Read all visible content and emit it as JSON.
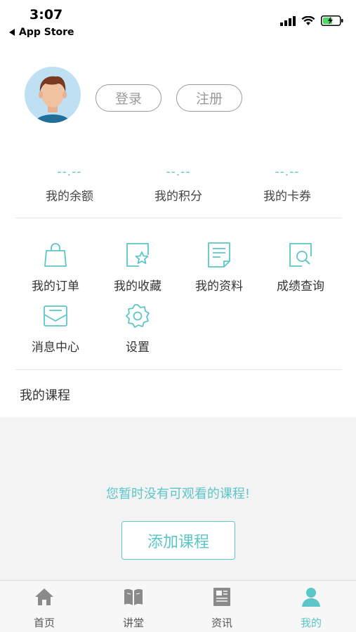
{
  "status_bar": {
    "time": "3:07",
    "back_label": "App Store"
  },
  "profile": {
    "login_label": "登录",
    "register_label": "注册"
  },
  "stats": [
    {
      "value": "--.--",
      "label": "我的余额"
    },
    {
      "value": "--.--",
      "label": "我的积分"
    },
    {
      "value": "--.--",
      "label": "我的卡券"
    }
  ],
  "menu": [
    {
      "label": "我的订单",
      "icon": "shopping-bag-icon"
    },
    {
      "label": "我的收藏",
      "icon": "star-icon"
    },
    {
      "label": "我的资料",
      "icon": "document-icon"
    },
    {
      "label": "成绩查询",
      "icon": "search-doc-icon"
    },
    {
      "label": "消息中心",
      "icon": "mail-icon"
    },
    {
      "label": "设置",
      "icon": "gear-icon"
    }
  ],
  "courses": {
    "title": "我的课程",
    "empty_message": "您暂时没有可观看的课程!",
    "add_label": "添加课程"
  },
  "tabbar": [
    {
      "label": "首页",
      "icon": "home-icon",
      "active": false
    },
    {
      "label": "讲堂",
      "icon": "book-icon",
      "active": false
    },
    {
      "label": "资讯",
      "icon": "newspaper-icon",
      "active": false
    },
    {
      "label": "我的",
      "icon": "person-icon",
      "active": true
    }
  ],
  "colors": {
    "accent": "#5cc6c8",
    "tab_inactive": "#555555"
  }
}
